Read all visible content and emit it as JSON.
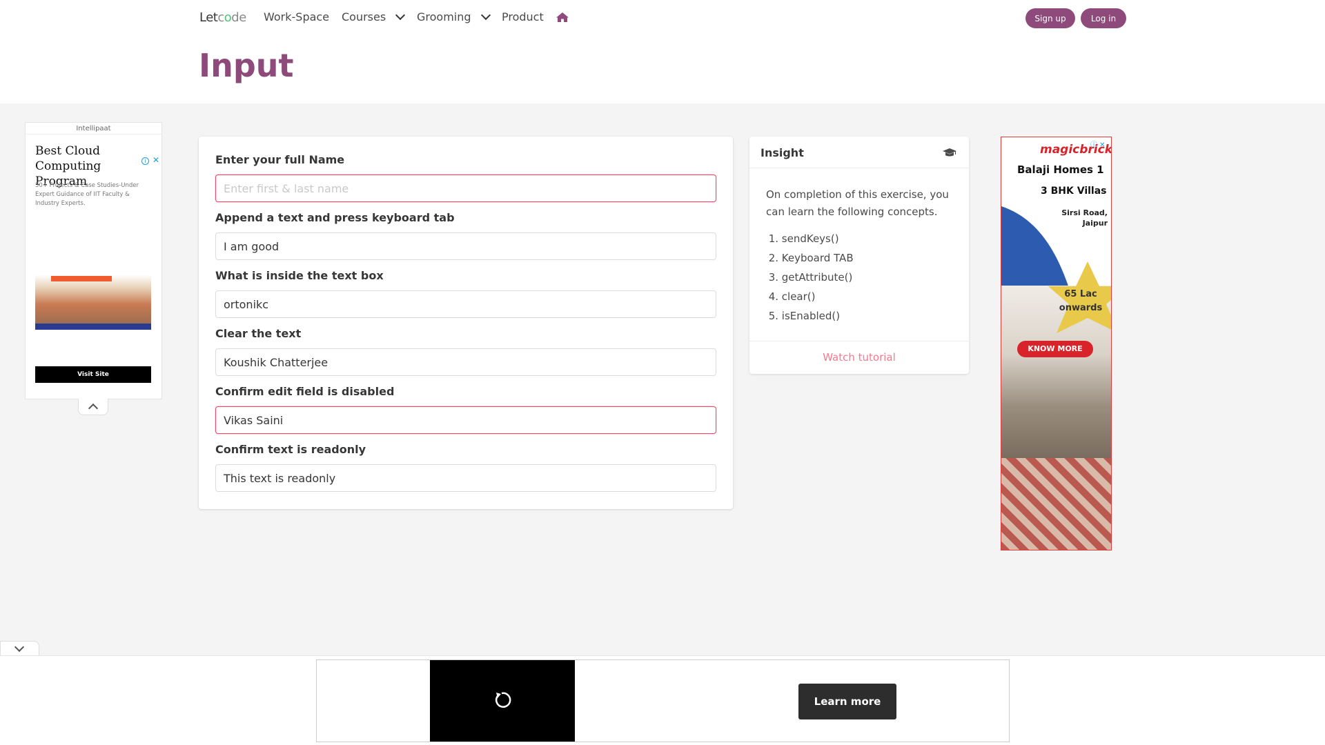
{
  "nav": {
    "logo_let": "Let",
    "logo_c": "c",
    "logo_o": "o",
    "logo_de": "de",
    "items": [
      {
        "label": "Work-Space"
      },
      {
        "label": "Courses"
      },
      {
        "label": "Grooming"
      },
      {
        "label": "Product"
      }
    ],
    "home_icon": "home-icon",
    "signup_label": "Sign up",
    "login_label": "Log in",
    "accent_color": "#8e4a7b"
  },
  "page": {
    "title": "Input"
  },
  "form": {
    "fields": [
      {
        "label": "Enter your full Name",
        "value": "",
        "placeholder": "Enter first & last name"
      },
      {
        "label": "Append a text and press keyboard tab",
        "value": "I am good",
        "placeholder": ""
      },
      {
        "label": "What is inside the text box",
        "value": "ortonikc",
        "placeholder": ""
      },
      {
        "label": "Clear the text",
        "value": "Koushik Chatterjee",
        "placeholder": ""
      },
      {
        "label": "Confirm edit field is disabled",
        "value": "Vikas Saini",
        "placeholder": ""
      },
      {
        "label": "Confirm text is readonly",
        "value": "This text is readonly",
        "placeholder": ""
      }
    ]
  },
  "insight": {
    "title": "Insight",
    "icon": "graduation-cap-icon",
    "description": "On completion of this exercise, you can learn the following concepts.",
    "concepts": [
      "sendKeys()",
      "Keyboard TAB",
      "getAttribute()",
      "clear()",
      "isEnabled()"
    ],
    "concept_numbers": [
      "1.",
      "2.",
      "3.",
      "4.",
      "5."
    ],
    "watch_label": "Watch tutorial",
    "link_color": "#f5788e"
  },
  "ad_left": {
    "brand": "Intellipaat",
    "title": "Best Cloud Computing Program",
    "subtitle": "50+ Projects & Case Studies-Under Expert Guidance of IIT Faculty & Industry Experts.",
    "cta": "Visit Site"
  },
  "ad_right": {
    "logo": "magicbricks",
    "title": "Balaji Homes 1",
    "subtitle": "3 BHK Villas",
    "location": "Sirsi Road, Jaipur",
    "price": "65 Lac onwards",
    "cta": "KNOW MORE"
  },
  "bottom_ad": {
    "cta": "Learn more",
    "replay_icon": "replay-icon"
  }
}
